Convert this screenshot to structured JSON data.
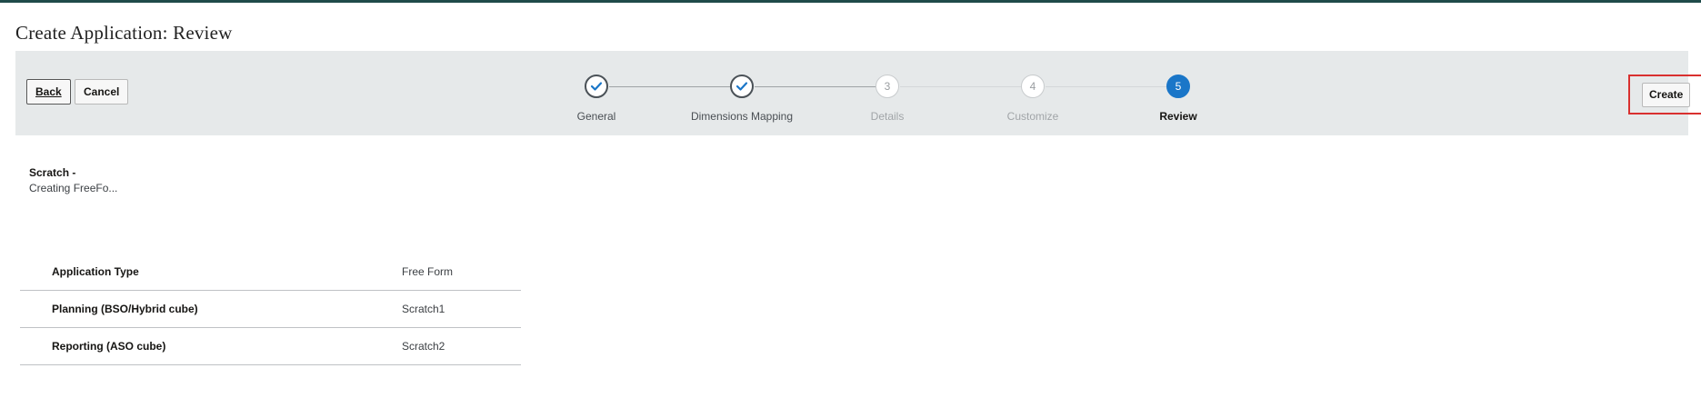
{
  "page": {
    "title": "Create Application: Review"
  },
  "toolbar": {
    "back_label": "Back",
    "cancel_label": "Cancel",
    "create_label": "Create"
  },
  "train": {
    "steps": [
      {
        "number": "1",
        "label": "General",
        "state": "done"
      },
      {
        "number": "2",
        "label": "Dimensions Mapping",
        "state": "done"
      },
      {
        "number": "3",
        "label": "Details",
        "state": "todo"
      },
      {
        "number": "4",
        "label": "Customize",
        "state": "todo"
      },
      {
        "number": "5",
        "label": "Review",
        "state": "current"
      }
    ]
  },
  "summary": {
    "title": "Scratch -",
    "subtitle": "Creating FreeFo..."
  },
  "details": {
    "rows": [
      {
        "label": "Application Type",
        "value": "Free Form"
      },
      {
        "label": "Planning (BSO/Hybrid cube)",
        "value": "Scratch1"
      },
      {
        "label": "Reporting (ASO cube)",
        "value": "Scratch2"
      }
    ]
  },
  "colors": {
    "accent": "#1a76c8",
    "highlight": "#d9302f",
    "bar": "#e6e9ea"
  }
}
